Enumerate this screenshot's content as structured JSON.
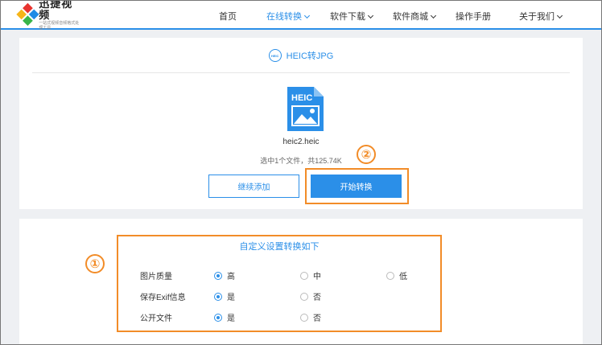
{
  "logo": {
    "name": "迅捷视频",
    "tagline": "一站式视频音频格式处理工具"
  },
  "nav": [
    {
      "label": "首页",
      "dropdown": false,
      "active": false
    },
    {
      "label": "在线转换",
      "dropdown": true,
      "active": true
    },
    {
      "label": "软件下载",
      "dropdown": true,
      "active": false
    },
    {
      "label": "软件商城",
      "dropdown": true,
      "active": false
    },
    {
      "label": "操作手册",
      "dropdown": false,
      "active": false
    },
    {
      "label": "关于我们",
      "dropdown": true,
      "active": false
    }
  ],
  "converter": {
    "title": "HEIC转JPG",
    "title_icon_text": "HEIC",
    "file_icon_label": "HEIC",
    "file_name": "heic2.heic",
    "file_info": "选中1个文件，共125.74K",
    "continue_label": "继续添加",
    "start_label": "开始转换"
  },
  "annotations": {
    "step1": "①",
    "step2": "②"
  },
  "settings": {
    "title": "自定义设置转换如下",
    "rows": [
      {
        "label": "图片质量",
        "options": [
          {
            "label": "高",
            "selected": true
          },
          {
            "label": "中",
            "selected": false
          },
          {
            "label": "低",
            "selected": false
          }
        ]
      },
      {
        "label": "保存Exif信息",
        "options": [
          {
            "label": "是",
            "selected": true
          },
          {
            "label": "否",
            "selected": false
          }
        ]
      },
      {
        "label": "公开文件",
        "options": [
          {
            "label": "是",
            "selected": true
          },
          {
            "label": "否",
            "selected": false
          }
        ]
      }
    ]
  },
  "colors": {
    "accent": "#2b8fe8",
    "highlight": "#f28c28",
    "background": "#eef0f3"
  }
}
